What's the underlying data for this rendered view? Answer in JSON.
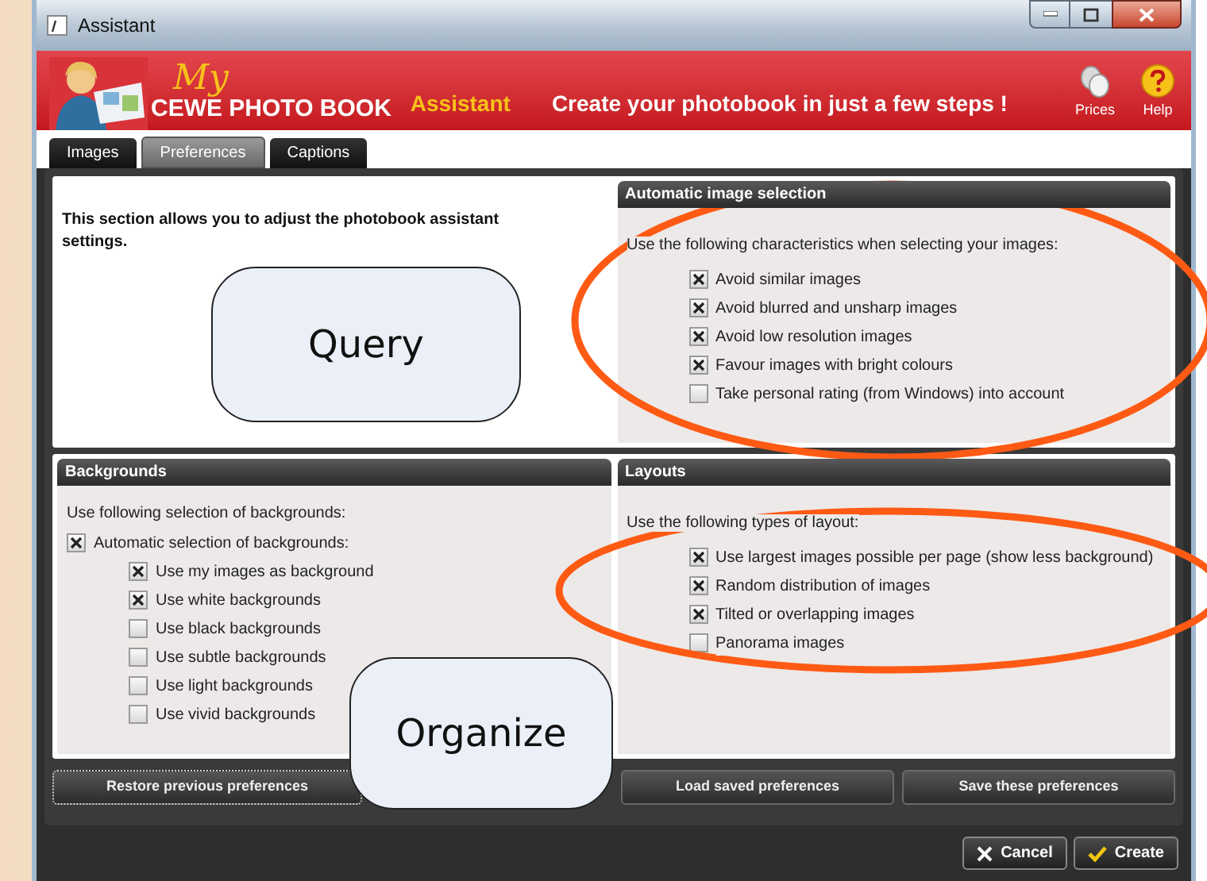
{
  "window": {
    "title": "Assistant"
  },
  "header": {
    "logo_top": "My",
    "logo_bottom": "CEWE PHOTO BOOK",
    "subtitle": "Assistant",
    "tagline": "Create your photobook in just a few steps !",
    "actions": [
      {
        "label": "Prices",
        "kind": "prices"
      },
      {
        "label": "Help",
        "kind": "help"
      }
    ]
  },
  "tabs": [
    {
      "label": "Images",
      "selected": false
    },
    {
      "label": "Preferences",
      "selected": true
    },
    {
      "label": "Captions",
      "selected": false
    }
  ],
  "intro": "This section allows you to adjust the photobook assistant settings.",
  "image_selection": {
    "title": "Automatic image selection",
    "prompt": "Use the following characteristics when selecting your images:",
    "options": [
      {
        "label": "Avoid similar images",
        "checked": true
      },
      {
        "label": "Avoid blurred and unsharp images",
        "checked": true
      },
      {
        "label": "Avoid low resolution images",
        "checked": true
      },
      {
        "label": "Favour images with bright colours",
        "checked": true
      },
      {
        "label": "Take personal rating (from Windows) into account",
        "checked": false
      }
    ]
  },
  "backgrounds": {
    "title": "Backgrounds",
    "prompt": "Use following selection of backgrounds:",
    "master": {
      "label": "Automatic selection of backgrounds:",
      "checked": true
    },
    "options": [
      {
        "label": "Use my images as background",
        "checked": true
      },
      {
        "label": "Use white backgrounds",
        "checked": true
      },
      {
        "label": "Use black backgrounds",
        "checked": false
      },
      {
        "label": "Use subtle backgrounds",
        "checked": false
      },
      {
        "label": "Use light backgrounds",
        "checked": false
      },
      {
        "label": "Use vivid backgrounds",
        "checked": false
      }
    ]
  },
  "layouts": {
    "title": "Layouts",
    "prompt": "Use the following types of layout:",
    "options": [
      {
        "label": "Use largest images possible per page (show less background)",
        "checked": true
      },
      {
        "label": "Random distribution of images",
        "checked": true
      },
      {
        "label": "Tilted or overlapping images",
        "checked": true
      },
      {
        "label": "Panorama images",
        "checked": false
      }
    ]
  },
  "preference_buttons": [
    {
      "label": "Restore previous preferences",
      "focused": true
    },
    {
      "label": "Load saved preferences",
      "focused": false
    },
    {
      "label": "Save these preferences",
      "focused": false
    }
  ],
  "dialog_buttons": [
    {
      "label": "Cancel",
      "kind": "cancel"
    },
    {
      "label": "Create",
      "kind": "create"
    }
  ],
  "annotations": [
    {
      "label": "Query"
    },
    {
      "label": "Organize"
    }
  ]
}
